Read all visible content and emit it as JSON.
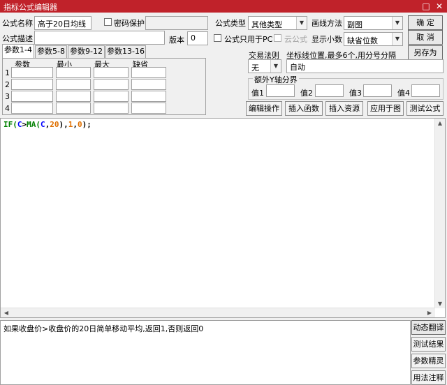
{
  "window": {
    "title": "指标公式编辑器"
  },
  "form": {
    "name_label": "公式名称",
    "name_value": "高于20日均线",
    "password_label": "密码保护",
    "desc_label": "公式描述",
    "desc_value": "",
    "version_label": "版本",
    "version_value": "0",
    "type_label": "公式类型",
    "type_value": "其他类型",
    "draw_label": "画线方法",
    "draw_value": "副图",
    "pc_only_label": "公式只用于PC",
    "cloud_label": "云公式",
    "decimals_label": "显示小数",
    "decimals_value": "缺省位数"
  },
  "buttons": {
    "ok": "确 定",
    "cancel": "取 消",
    "save_as": "另存为",
    "edit_op": "编辑操作",
    "insert_func": "插入函数",
    "insert_res": "插入资源",
    "apply": "应用于图",
    "test": "测试公式",
    "dyn_translate": "动态翻译",
    "test_result": "测试结果",
    "param_wizard": "参数精灵",
    "usage_notes": "用法注释"
  },
  "params": {
    "tabs": [
      "参数1-4",
      "参数5-8",
      "参数9-12",
      "参数13-16"
    ],
    "headers": [
      "参数",
      "最小",
      "最大",
      "缺省"
    ],
    "rows": [
      "1",
      "2",
      "3",
      "4"
    ]
  },
  "trade": {
    "rule_label": "交易法则",
    "rule_value": "无",
    "axis_label": "坐标线位置,最多6个,用分号分隔",
    "axis_value": "自动"
  },
  "extra_y": {
    "title": "额外Y轴分界",
    "labels": [
      "值1",
      "值2",
      "值3",
      "值4"
    ]
  },
  "code": {
    "tokens": [
      {
        "t": "IF(",
        "c": "#008000"
      },
      {
        "t": "C",
        "c": "#0000ff"
      },
      {
        "t": ">",
        "c": "#000000"
      },
      {
        "t": "MA(",
        "c": "#008000"
      },
      {
        "t": "C",
        "c": "#0000ff"
      },
      {
        "t": ",",
        "c": "#000000"
      },
      {
        "t": "20",
        "c": "#e07000"
      },
      {
        "t": "),",
        "c": "#000000"
      },
      {
        "t": "1",
        "c": "#e07000"
      },
      {
        "t": ",",
        "c": "#000000"
      },
      {
        "t": "0",
        "c": "#e07000"
      },
      {
        "t": ");",
        "c": "#000000"
      }
    ]
  },
  "output": {
    "text": "如果收盘价>收盘价的20日简单移动平均,返回1,否则返回0"
  }
}
